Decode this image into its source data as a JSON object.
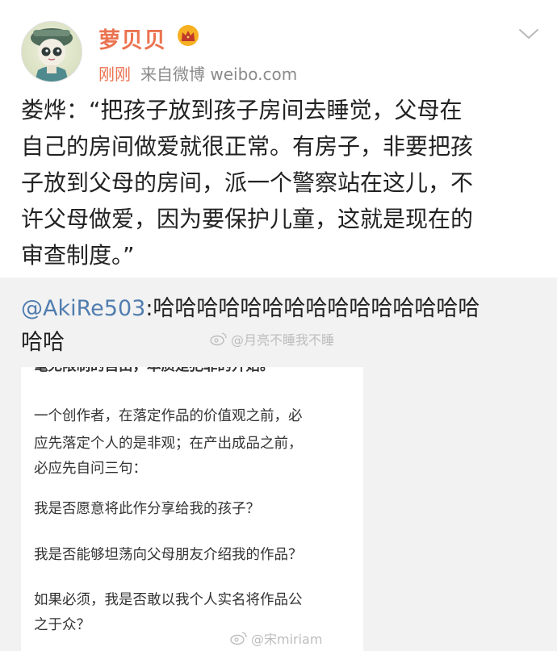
{
  "post": {
    "username": "萝贝贝",
    "time": "刚刚",
    "source": "来自微博 weibo.com",
    "text_lines": [
      "娄烨：“把孩子放到孩子房间去睡觉，父母在",
      "自己的房间做爱就很正常。有房子，非要把孩",
      "子放到父母的房间，派一个警察站在这儿，不",
      "许父母做爱，因为要保护儿童，这就是现在的",
      "审查制度。”"
    ]
  },
  "repost": {
    "mention": "@AkiRe503",
    "text_line1": ":哈哈哈哈哈哈哈哈哈哈哈哈哈哈哈",
    "text_line2": "哈哈",
    "watermark1": "@月亮不睡我不睡",
    "watermark2": "@宋miriam",
    "doc_lines": [
      "毫无限制的自由，本质是犯罪的开始。",
      "一个创作者，在落定作品的价值观之前，必",
      "应先落定个人的是非观；在产出成品之前，",
      "必应先自问三句：",
      "我是否愿意将此作分享给我的孩子？",
      "我是否能够坦荡向父母朋友介绍我的作品？",
      "如果必须，我是否敢以我个人实名将作品公",
      "之于众？"
    ]
  },
  "icons": {
    "crown": "crown-icon",
    "chevron": "chevron-down-icon",
    "weibo": "weibo-logo-icon"
  },
  "colors": {
    "username": "#eb7350",
    "mention": "#507daf",
    "meta": "#8a8a8a",
    "repost_bg": "#f2f2f2"
  }
}
